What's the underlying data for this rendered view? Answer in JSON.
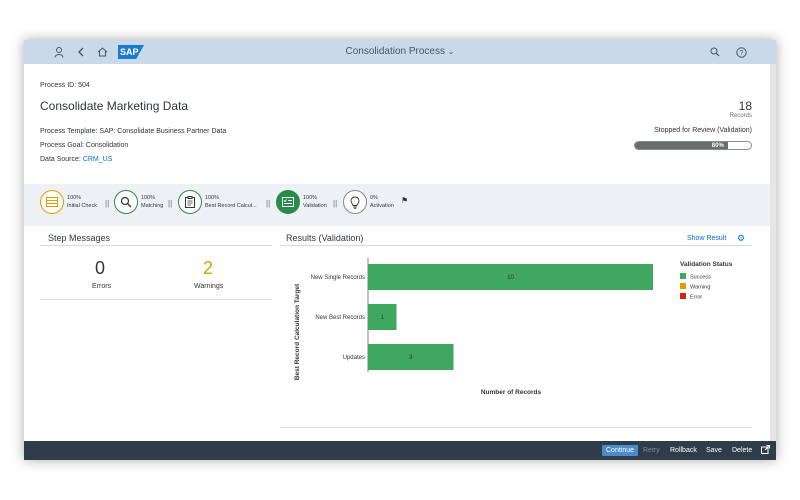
{
  "shell": {
    "title": "Consolidation Process",
    "logo_text": "SAP",
    "icons": [
      "user-icon",
      "back-icon",
      "home-icon",
      "search-icon",
      "help-icon"
    ]
  },
  "header": {
    "process_id": "Process ID: 504",
    "title": "Consolidate Marketing Data",
    "template": "Process Template: SAP: Consolidate Business Partner Data",
    "goal": "Process Goal: Consolidation",
    "source_label": "Data Source: ",
    "source_value": "CRM_US",
    "records_count": "18",
    "records_label": "Records",
    "status_text": "Stopped for Review (Validation)",
    "progress_value": 0.8,
    "progress_label": "80%"
  },
  "steps": [
    {
      "percent": "100%",
      "label": "Initial Check",
      "icon": "table-icon"
    },
    {
      "percent": "100%",
      "label": "Matching",
      "icon": "magnifier-icon"
    },
    {
      "percent": "100%",
      "label": "Best Record Calcul...",
      "icon": "clipboard-icon"
    },
    {
      "percent": "100%",
      "label": "Validation",
      "icon": "checklist-icon"
    },
    {
      "percent": "0%",
      "label": "Activation",
      "icon": "lightbulb-icon"
    }
  ],
  "step_messages": {
    "title": "Step Messages",
    "errors_count": "0",
    "errors_label": "Errors",
    "warnings_count": "2",
    "warnings_label": "Warnings"
  },
  "results": {
    "title": "Results (Validation)",
    "show_result": "Show Result"
  },
  "chart_data": {
    "type": "bar",
    "orientation": "horizontal",
    "categories": [
      "New Single Records",
      "New Best Records",
      "Updates"
    ],
    "values": [
      10,
      1,
      3
    ],
    "xlabel": "Number of Records",
    "ylabel": "Best Record Calculation Target",
    "xlim": [
      0,
      10
    ],
    "bar_color": "#3fa75f",
    "legend": {
      "title": "Validation Status",
      "position": "right",
      "items": [
        {
          "name": "Success",
          "color": "#3fa75f"
        },
        {
          "name": "Warning",
          "color": "#e09d00"
        },
        {
          "name": "Error",
          "color": "#d0271d"
        }
      ]
    }
  },
  "footer": {
    "continue": "Continue",
    "retry": "Retry",
    "rollback": "Rollback",
    "save": "Save",
    "delete": "Delete"
  }
}
